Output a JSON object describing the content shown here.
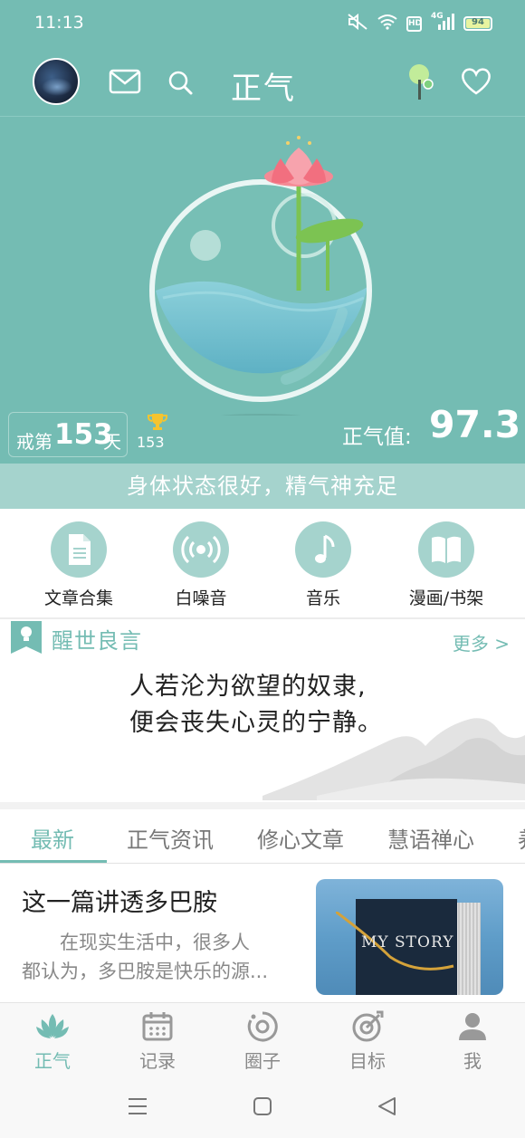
{
  "status_bar": {
    "time": "11:13",
    "hd": "HD",
    "network": "4G",
    "battery": "94",
    "icons": [
      "mute-icon",
      "wifi-icon",
      "hd-icon",
      "signal-icon",
      "battery-icon"
    ]
  },
  "header": {
    "title": "正气",
    "icons": [
      "avatar",
      "mail-icon",
      "search-icon",
      "tree-icon",
      "heart-icon"
    ]
  },
  "hero": {
    "days_prefix": "戒第",
    "days_count": "153",
    "days_suffix": "天",
    "trophy_count": "153",
    "score_label": "正气值:",
    "score_value": "97.3",
    "status_message": "身体状态很好，精气神充足"
  },
  "quick_menu": [
    {
      "label": "文章合集",
      "icon": "document-icon"
    },
    {
      "label": "白噪音",
      "icon": "broadcast-icon"
    },
    {
      "label": "音乐",
      "icon": "music-note-icon"
    },
    {
      "label": "漫画/书架",
      "icon": "book-icon"
    }
  ],
  "quote": {
    "title": "醒世良言",
    "more": "更多 >",
    "line1": "人若沦为欲望的奴隶,",
    "line2": "便会丧失心灵的宁静。"
  },
  "tabs": [
    "最新",
    "正气资讯",
    "修心文章",
    "慧语禅心",
    "养"
  ],
  "article": {
    "title": "这一篇讲透多巴胺",
    "excerpt_line1": "在现实生活中，很多人",
    "excerpt_line2": "都认为，多巴胺是快乐的源...",
    "thumbnail_text": "MY STORY"
  },
  "bottom_nav": [
    {
      "label": "正气",
      "icon": "lotus-icon",
      "active": true
    },
    {
      "label": "记录",
      "icon": "calendar-icon",
      "active": false
    },
    {
      "label": "圈子",
      "icon": "circle-icon",
      "active": false
    },
    {
      "label": "目标",
      "icon": "target-icon",
      "active": false
    },
    {
      "label": "我",
      "icon": "person-icon",
      "active": false
    }
  ],
  "colors": {
    "accent": "#74bcb3",
    "accent_light": "#a5d3cd",
    "lotus_pink": "#f48a95",
    "leaf_green": "#7cc352"
  }
}
